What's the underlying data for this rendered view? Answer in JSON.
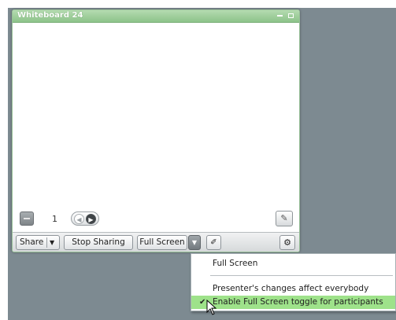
{
  "window": {
    "title": "Whiteboard 24"
  },
  "navigation": {
    "page_number": "1"
  },
  "toolbar": {
    "share_label": "Share",
    "stop_sharing_label": "Stop Sharing",
    "full_screen_label": "Full Screen"
  },
  "menu": {
    "items": [
      {
        "label": "Full Screen",
        "checked": false
      },
      {
        "label": "Presenter's changes affect everybody",
        "checked": false
      },
      {
        "label": "Enable Full Screen toggle for participants",
        "checked": true,
        "highlighted": true
      }
    ],
    "check_glyph": "✔"
  },
  "colors": {
    "title_bar": "#9fcf9b",
    "menu_highlight": "#9ee28a",
    "stage_background": "#7d8a91"
  },
  "icons": {
    "remove_page": "minus-icon",
    "prev_page": "arrow-left-icon",
    "next_page": "arrow-right-icon",
    "edit": "edit-icon",
    "sketch": "pencil-icon",
    "options": "gear-icon",
    "dropdown": "chevron-down-icon"
  }
}
